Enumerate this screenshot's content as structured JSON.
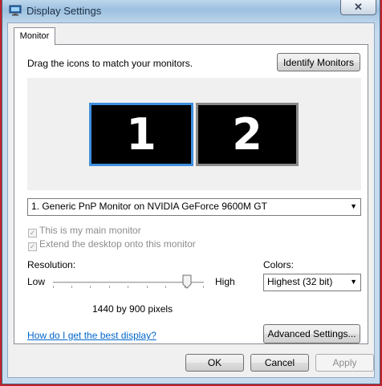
{
  "window": {
    "title": "Display Settings",
    "close_glyph": "✕",
    "app_icon": "display-settings-icon"
  },
  "tabs": [
    {
      "label": "Monitor",
      "selected": true
    }
  ],
  "monitor_tab": {
    "instruction": "Drag the icons to match your monitors.",
    "identify_label": "Identify Monitors",
    "monitors": [
      {
        "number": "1",
        "selected": true
      },
      {
        "number": "2",
        "selected": false
      }
    ],
    "monitor_select_value": "1. Generic PnP Monitor on NVIDIA GeForce 9600M GT",
    "main_monitor_label": "This is my main monitor",
    "main_monitor_checked": true,
    "extend_label": "Extend the desktop onto this monitor",
    "extend_checked": true,
    "resolution": {
      "label": "Resolution:",
      "low": "Low",
      "high": "High",
      "value_text": "1440 by 900 pixels",
      "slider_level_percent": 88
    },
    "colors": {
      "label": "Colors:",
      "value": "Highest (32 bit)"
    },
    "help_link": "How do I get the best display?",
    "advanced_label": "Advanced Settings..."
  },
  "footer": {
    "ok_label": "OK",
    "cancel_label": "Cancel",
    "apply_label": "Apply",
    "apply_enabled": false
  },
  "colors_theme": {
    "selected_monitor_border": "#3f8fde",
    "link": "#0066cc",
    "desktop_red": "#c4212a"
  }
}
